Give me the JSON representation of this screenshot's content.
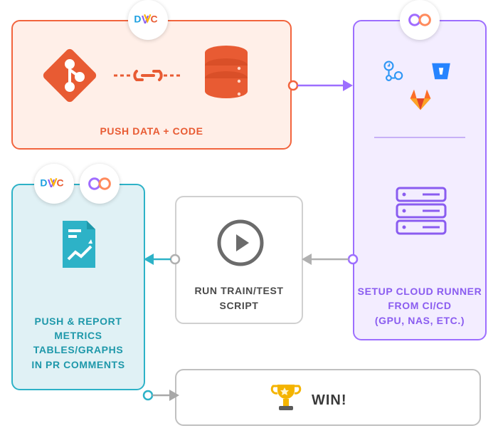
{
  "badges": {
    "dvc_top": "DVC",
    "cml_top": "CML",
    "dvc_left": "DVC",
    "cml_left": "CML"
  },
  "orange": {
    "caption": "PUSH DATA + CODE"
  },
  "purple": {
    "caption_line1": "SETUP CLOUD RUNNER",
    "caption_line2": "FROM CI/CD",
    "caption_line3": "(GPU, NAS, ETC.)"
  },
  "center": {
    "caption_line1": "RUN TRAIN/TEST",
    "caption_line2": "SCRIPT"
  },
  "teal": {
    "caption_line1": "PUSH & REPORT",
    "caption_line2": "METRICS",
    "caption_line3": "TABLES/GRAPHS",
    "caption_line4": "IN PR COMMENTS"
  },
  "win": {
    "caption": "WIN!"
  },
  "icons": {
    "git": "git-icon",
    "link": "link-icon",
    "database": "database-icon",
    "github_actions": "github-actions-icon",
    "bitbucket": "bitbucket-icon",
    "gitlab": "gitlab-icon",
    "servers": "servers-icon",
    "play": "play-icon",
    "report": "report-chart-icon",
    "trophy": "trophy-icon",
    "dvc_logo": "dvc-logo",
    "cml_logo": "cml-logo"
  }
}
